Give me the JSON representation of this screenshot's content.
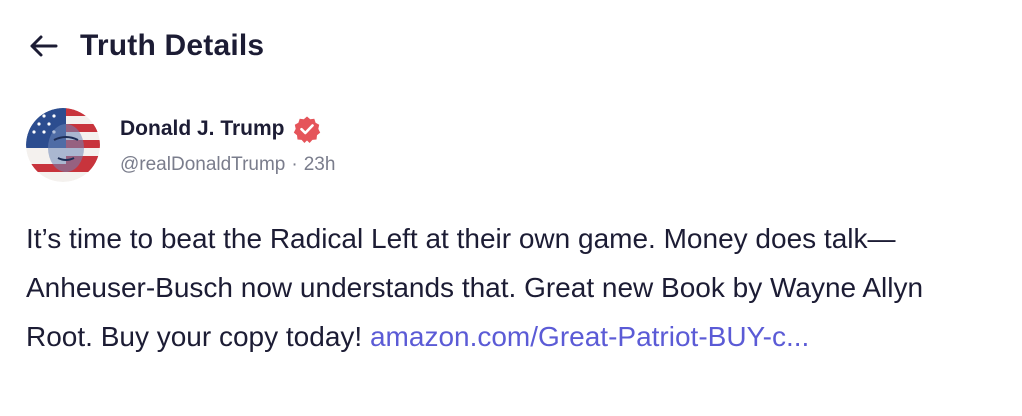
{
  "header": {
    "title": "Truth Details",
    "back_icon": "arrow-left-icon"
  },
  "post": {
    "author": {
      "name": "Donald J. Trump",
      "handle": "@realDonaldTrump",
      "separator": "·",
      "time": "23h",
      "verified_icon": "verified-badge-icon",
      "verified_color": "#e5545a"
    },
    "text": "It’s time to beat the Radical Left at their own game. Money does talk—Anheuser-Busch now understands that. Great new Book by Wayne Allyn Root. Buy your copy today! ",
    "link_text": "amazon.com/Great-Patriot-BUY-c...",
    "link_color": "#5b5bd6"
  }
}
